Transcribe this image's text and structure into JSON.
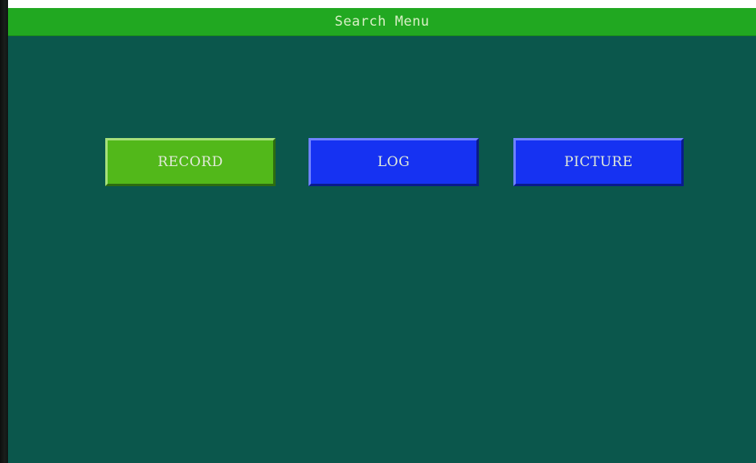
{
  "window": {
    "title": "Search Menu"
  },
  "menu": {
    "buttons": [
      {
        "id": "record",
        "label": "RECORD",
        "selected": true
      },
      {
        "id": "log",
        "label": "LOG",
        "selected": false
      },
      {
        "id": "picture",
        "label": "PICTURE",
        "selected": false
      }
    ]
  },
  "colors": {
    "background": "#0b574c",
    "title_bar": "#21a821",
    "selected_button": "#52b81a",
    "button": "#1632f2",
    "text": "#e2ead9"
  }
}
